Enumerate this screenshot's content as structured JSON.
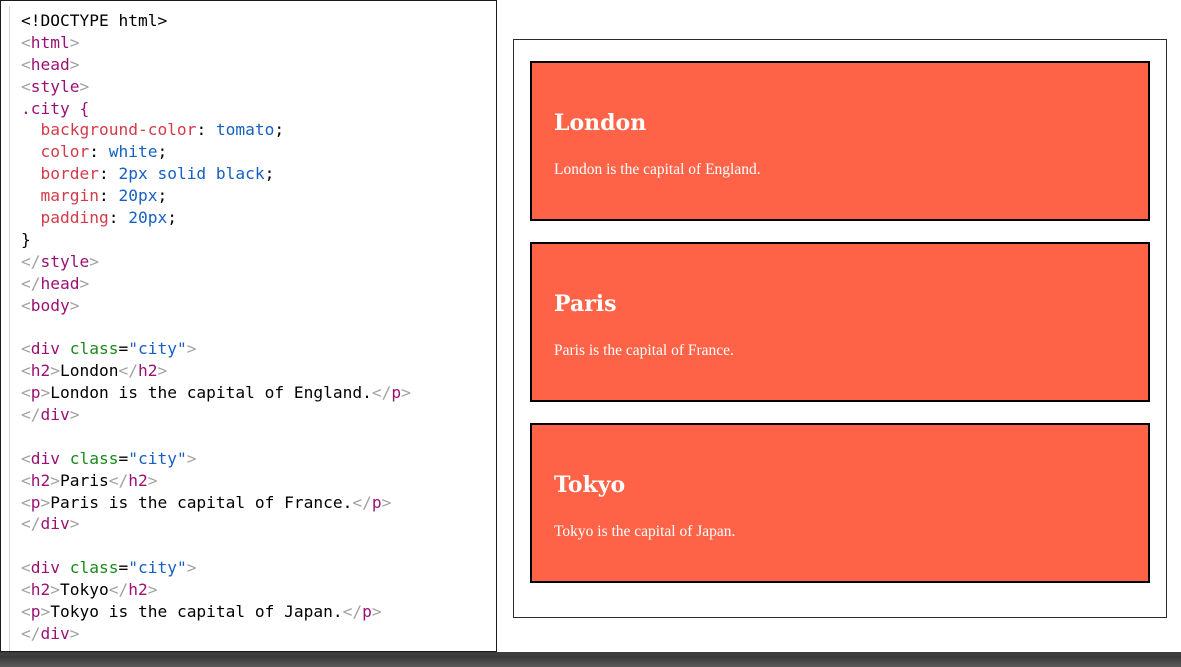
{
  "editor": {
    "lines": [
      [
        {
          "t": "<!DOCTYPE html>",
          "c": "plain"
        }
      ],
      [
        {
          "t": "<",
          "c": "punct"
        },
        {
          "t": "html",
          "c": "tag"
        },
        {
          "t": ">",
          "c": "punct"
        }
      ],
      [
        {
          "t": "<",
          "c": "punct"
        },
        {
          "t": "head",
          "c": "tag"
        },
        {
          "t": ">",
          "c": "punct"
        }
      ],
      [
        {
          "t": "<",
          "c": "punct"
        },
        {
          "t": "style",
          "c": "tag"
        },
        {
          "t": ">",
          "c": "punct"
        }
      ],
      [
        {
          "t": ".city {",
          "c": "tag"
        }
      ],
      [
        {
          "t": "  background-color",
          "c": "prop"
        },
        {
          "t": ": ",
          "c": "plain"
        },
        {
          "t": "tomato",
          "c": "val"
        },
        {
          "t": ";",
          "c": "plain"
        }
      ],
      [
        {
          "t": "  color",
          "c": "prop"
        },
        {
          "t": ": ",
          "c": "plain"
        },
        {
          "t": "white",
          "c": "val"
        },
        {
          "t": ";",
          "c": "plain"
        }
      ],
      [
        {
          "t": "  border",
          "c": "prop"
        },
        {
          "t": ": ",
          "c": "plain"
        },
        {
          "t": "2px solid black",
          "c": "val"
        },
        {
          "t": ";",
          "c": "plain"
        }
      ],
      [
        {
          "t": "  margin",
          "c": "prop"
        },
        {
          "t": ": ",
          "c": "plain"
        },
        {
          "t": "20px",
          "c": "val"
        },
        {
          "t": ";",
          "c": "plain"
        }
      ],
      [
        {
          "t": "  padding",
          "c": "prop"
        },
        {
          "t": ": ",
          "c": "plain"
        },
        {
          "t": "20px",
          "c": "val"
        },
        {
          "t": ";",
          "c": "plain"
        }
      ],
      [
        {
          "t": "}",
          "c": "plain"
        }
      ],
      [
        {
          "t": "</",
          "c": "punct"
        },
        {
          "t": "style",
          "c": "tag"
        },
        {
          "t": ">",
          "c": "punct"
        }
      ],
      [
        {
          "t": "</",
          "c": "punct"
        },
        {
          "t": "head",
          "c": "tag"
        },
        {
          "t": ">",
          "c": "punct"
        }
      ],
      [
        {
          "t": "<",
          "c": "punct"
        },
        {
          "t": "body",
          "c": "tag"
        },
        {
          "t": ">",
          "c": "punct"
        }
      ],
      [],
      [
        {
          "t": "<",
          "c": "punct"
        },
        {
          "t": "div",
          "c": "tag"
        },
        {
          "t": " class",
          "c": "attr"
        },
        {
          "t": "=",
          "c": "plain"
        },
        {
          "t": "\"city\"",
          "c": "str"
        },
        {
          "t": ">",
          "c": "punct"
        }
      ],
      [
        {
          "t": "<",
          "c": "punct"
        },
        {
          "t": "h2",
          "c": "tag"
        },
        {
          "t": ">",
          "c": "punct"
        },
        {
          "t": "London",
          "c": "plain"
        },
        {
          "t": "</",
          "c": "punct"
        },
        {
          "t": "h2",
          "c": "tag"
        },
        {
          "t": ">",
          "c": "punct"
        }
      ],
      [
        {
          "t": "<",
          "c": "punct"
        },
        {
          "t": "p",
          "c": "tag"
        },
        {
          "t": ">",
          "c": "punct"
        },
        {
          "t": "London is the capital of England.",
          "c": "plain"
        },
        {
          "t": "</",
          "c": "punct"
        },
        {
          "t": "p",
          "c": "tag"
        },
        {
          "t": ">",
          "c": "punct"
        }
      ],
      [
        {
          "t": "</",
          "c": "punct"
        },
        {
          "t": "div",
          "c": "tag"
        },
        {
          "t": ">",
          "c": "punct"
        }
      ],
      [],
      [
        {
          "t": "<",
          "c": "punct"
        },
        {
          "t": "div",
          "c": "tag"
        },
        {
          "t": " class",
          "c": "attr"
        },
        {
          "t": "=",
          "c": "plain"
        },
        {
          "t": "\"city\"",
          "c": "str"
        },
        {
          "t": ">",
          "c": "punct"
        }
      ],
      [
        {
          "t": "<",
          "c": "punct"
        },
        {
          "t": "h2",
          "c": "tag"
        },
        {
          "t": ">",
          "c": "punct"
        },
        {
          "t": "Paris",
          "c": "plain"
        },
        {
          "t": "</",
          "c": "punct"
        },
        {
          "t": "h2",
          "c": "tag"
        },
        {
          "t": ">",
          "c": "punct"
        }
      ],
      [
        {
          "t": "<",
          "c": "punct"
        },
        {
          "t": "p",
          "c": "tag"
        },
        {
          "t": ">",
          "c": "punct"
        },
        {
          "t": "Paris is the capital of France.",
          "c": "plain"
        },
        {
          "t": "</",
          "c": "punct"
        },
        {
          "t": "p",
          "c": "tag"
        },
        {
          "t": ">",
          "c": "punct"
        }
      ],
      [
        {
          "t": "</",
          "c": "punct"
        },
        {
          "t": "div",
          "c": "tag"
        },
        {
          "t": ">",
          "c": "punct"
        }
      ],
      [],
      [
        {
          "t": "<",
          "c": "punct"
        },
        {
          "t": "div",
          "c": "tag"
        },
        {
          "t": " class",
          "c": "attr"
        },
        {
          "t": "=",
          "c": "plain"
        },
        {
          "t": "\"city\"",
          "c": "str"
        },
        {
          "t": ">",
          "c": "punct"
        }
      ],
      [
        {
          "t": "<",
          "c": "punct"
        },
        {
          "t": "h2",
          "c": "tag"
        },
        {
          "t": ">",
          "c": "punct"
        },
        {
          "t": "Tokyo",
          "c": "plain"
        },
        {
          "t": "</",
          "c": "punct"
        },
        {
          "t": "h2",
          "c": "tag"
        },
        {
          "t": ">",
          "c": "punct"
        }
      ],
      [
        {
          "t": "<",
          "c": "punct"
        },
        {
          "t": "p",
          "c": "tag"
        },
        {
          "t": ">",
          "c": "punct"
        },
        {
          "t": "Tokyo is the capital of Japan.",
          "c": "plain"
        },
        {
          "t": "</",
          "c": "punct"
        },
        {
          "t": "p",
          "c": "tag"
        },
        {
          "t": ">",
          "c": "punct"
        }
      ],
      [
        {
          "t": "</",
          "c": "punct"
        },
        {
          "t": "div",
          "c": "tag"
        },
        {
          "t": ">",
          "c": "punct"
        }
      ]
    ]
  },
  "preview": {
    "cities": [
      {
        "name": "London",
        "description": "London is the capital of England."
      },
      {
        "name": "Paris",
        "description": "Paris is the capital of France."
      },
      {
        "name": "Tokyo",
        "description": "Tokyo is the capital of Japan."
      }
    ]
  },
  "colors": {
    "city_background": "#ff6347",
    "city_text": "#ffffff",
    "city_border": "#000000",
    "syntax_tag": "#9b1173",
    "syntax_property": "#d33b48",
    "syntax_value": "#1560c2",
    "syntax_attribute": "#1a8b1a"
  }
}
